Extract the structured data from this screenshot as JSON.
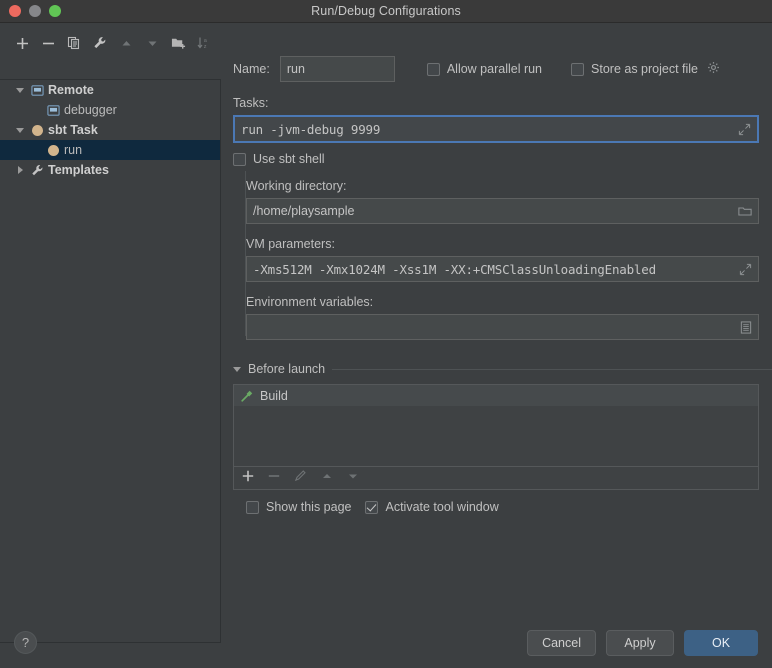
{
  "window": {
    "title": "Run/Debug Configurations",
    "traffic_lights": [
      "close-button",
      "minimize-button",
      "maximize-button"
    ]
  },
  "toolbar": {
    "buttons": [
      {
        "name": "add-configuration-button",
        "icon": "plus-icon",
        "enabled": true
      },
      {
        "name": "remove-configuration-button",
        "icon": "minus-icon",
        "enabled": true
      },
      {
        "name": "copy-configuration-button",
        "icon": "copy-icon",
        "enabled": true
      },
      {
        "name": "edit-templates-button",
        "icon": "wrench-icon",
        "enabled": true
      },
      {
        "name": "move-up-button",
        "icon": "arrow-up-icon",
        "enabled": false
      },
      {
        "name": "move-down-button",
        "icon": "arrow-down-icon",
        "enabled": false
      },
      {
        "name": "create-folder-button",
        "icon": "folder-add-icon",
        "enabled": true
      },
      {
        "name": "sort-configurations-button",
        "icon": "sort-az-icon",
        "enabled": false
      }
    ]
  },
  "sidebar": {
    "items": [
      {
        "label": "Remote",
        "icon": "remote-icon",
        "expander": "down",
        "indent": 0,
        "bold": true,
        "selected": false
      },
      {
        "label": "debugger",
        "icon": "remote-icon",
        "expander": "none",
        "indent": 1,
        "bold": false,
        "selected": false
      },
      {
        "label": "sbt Task",
        "icon": "sbt-task-icon",
        "expander": "down",
        "indent": 0,
        "bold": true,
        "selected": false
      },
      {
        "label": "run",
        "icon": "sbt-task-icon",
        "expander": "none",
        "indent": 1,
        "bold": false,
        "selected": true
      },
      {
        "label": "Templates",
        "icon": "wrench-icon",
        "expander": "right",
        "indent": 0,
        "bold": true,
        "selected": false
      }
    ]
  },
  "form": {
    "name_label": "Name:",
    "name_value": "run",
    "allow_parallel_run": {
      "label": "Allow parallel run",
      "checked": false
    },
    "store_as_project_file": {
      "label": "Store as project file",
      "checked": false,
      "icon": "gear-icon"
    },
    "tasks_label": "Tasks:",
    "tasks_value": "run -jvm-debug 9999",
    "tasks_expand_icon": "expand-icon",
    "use_sbt_shell": {
      "label": "Use sbt shell",
      "checked": false
    },
    "working_directory_label": "Working directory:",
    "working_directory_value": "/home/playsample",
    "working_directory_icon": "folder-icon",
    "vm_parameters_label": "VM parameters:",
    "vm_parameters_value": "-Xms512M -Xmx1024M -Xss1M -XX:+CMSClassUnloadingEnabled",
    "vm_parameters_expand_icon": "expand-icon",
    "environment_variables_label": "Environment variables:",
    "environment_variables_value": "",
    "environment_variables_icon": "list-icon"
  },
  "before_launch": {
    "section_label": "Before launch",
    "items": [
      {
        "label": "Build",
        "icon": "build-hammer-icon"
      }
    ],
    "toolbar": [
      {
        "name": "add-task-button",
        "icon": "plus-icon",
        "enabled": true
      },
      {
        "name": "remove-task-button",
        "icon": "minus-icon",
        "enabled": false
      },
      {
        "name": "edit-task-button",
        "icon": "pencil-icon",
        "enabled": false
      },
      {
        "name": "move-task-up-button",
        "icon": "arrow-up-icon",
        "enabled": false
      },
      {
        "name": "move-task-down-button",
        "icon": "arrow-down-icon",
        "enabled": false
      }
    ],
    "show_this_page": {
      "label": "Show this page",
      "checked": false
    },
    "activate_tool_window": {
      "label": "Activate tool window",
      "checked": true
    }
  },
  "footer": {
    "help_label": "?",
    "cancel_label": "Cancel",
    "apply_label": "Apply",
    "ok_label": "OK"
  },
  "colors": {
    "window_bg": "#3c3f41",
    "titlebar_bg": "#3a3a3a",
    "selection_bg": "#0f293e",
    "focus_border": "#4b78b4",
    "primary_button": "#3d6185",
    "build_icon_green": "#6aaa64",
    "task_icon_tan": "#d2b48c"
  }
}
